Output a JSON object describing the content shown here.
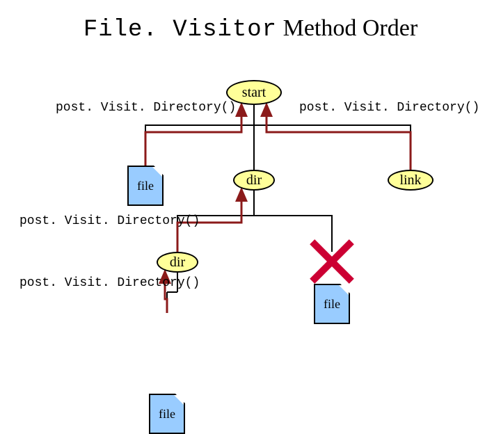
{
  "title": {
    "mono": "File. Visitor",
    "rest": " Method Order"
  },
  "nodes": {
    "start": "start",
    "file1": "file",
    "dir1": "dir",
    "link1": "link",
    "dir2": "dir",
    "file2": "file",
    "hidden_file": "file"
  },
  "labels": {
    "pvd_top_left": "post. Visit. Directory()",
    "pvd_top_right": "post. Visit. Directory()",
    "pvd_mid": "post. Visit. Directory()",
    "pvd_low": "post. Visit. Directory()"
  }
}
